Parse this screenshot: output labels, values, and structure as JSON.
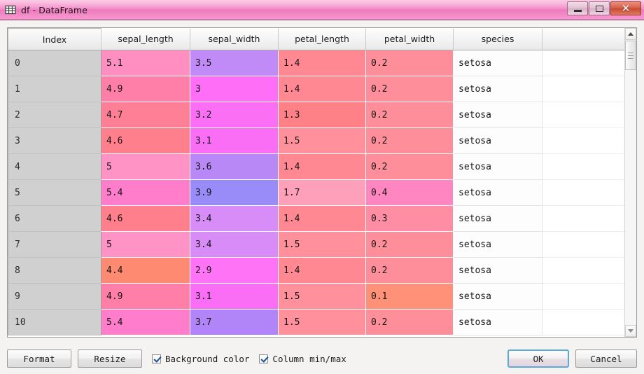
{
  "window": {
    "title": "df - DataFrame",
    "icon": "table-grid-icon",
    "minimize_label": "–",
    "maximize_label": "❐",
    "close_label": "✕"
  },
  "table": {
    "columns": [
      "Index",
      "sepal_length",
      "sepal_width",
      "petal_length",
      "petal_width",
      "species",
      ""
    ],
    "rows": [
      {
        "index": "0",
        "sepal_length": "5.1",
        "sepal_width": "3.5",
        "petal_length": "1.4",
        "petal_width": "0.2",
        "species": "setosa"
      },
      {
        "index": "1",
        "sepal_length": "4.9",
        "sepal_width": "3",
        "petal_length": "1.4",
        "petal_width": "0.2",
        "species": "setosa"
      },
      {
        "index": "2",
        "sepal_length": "4.7",
        "sepal_width": "3.2",
        "petal_length": "1.3",
        "petal_width": "0.2",
        "species": "setosa"
      },
      {
        "index": "3",
        "sepal_length": "4.6",
        "sepal_width": "3.1",
        "petal_length": "1.5",
        "petal_width": "0.2",
        "species": "setosa"
      },
      {
        "index": "4",
        "sepal_length": "5",
        "sepal_width": "3.6",
        "petal_length": "1.4",
        "petal_width": "0.2",
        "species": "setosa"
      },
      {
        "index": "5",
        "sepal_length": "5.4",
        "sepal_width": "3.9",
        "petal_length": "1.7",
        "petal_width": "0.4",
        "species": "setosa"
      },
      {
        "index": "6",
        "sepal_length": "4.6",
        "sepal_width": "3.4",
        "petal_length": "1.4",
        "petal_width": "0.3",
        "species": "setosa"
      },
      {
        "index": "7",
        "sepal_length": "5",
        "sepal_width": "3.4",
        "petal_length": "1.5",
        "petal_width": "0.2",
        "species": "setosa"
      },
      {
        "index": "8",
        "sepal_length": "4.4",
        "sepal_width": "2.9",
        "petal_length": "1.4",
        "petal_width": "0.2",
        "species": "setosa"
      },
      {
        "index": "9",
        "sepal_length": "4.9",
        "sepal_width": "3.1",
        "petal_length": "1.5",
        "petal_width": "0.1",
        "species": "setosa"
      },
      {
        "index": "10",
        "sepal_length": "5.4",
        "sepal_width": "3.7",
        "petal_length": "1.5",
        "petal_width": "0.2",
        "species": "setosa"
      }
    ],
    "cell_colors": {
      "sepal_length": [
        "#ff8fc0",
        "#ff7fa8",
        "#ff7f96",
        "#ff7f8c",
        "#ff93c6",
        "#ff7dcb",
        "#ff7f8c",
        "#ff93c6",
        "#ff8a72",
        "#ff7fa8",
        "#ff7dcb"
      ],
      "sepal_width": [
        "#c18bf7",
        "#ff6ef7",
        "#fb6ff5",
        "#f96ef4",
        "#b888f6",
        "#9a8cf8",
        "#d78cf7",
        "#d78cf7",
        "#ff73f6",
        "#f96ef4",
        "#b184f7"
      ],
      "petal_length": [
        "#ff8893",
        "#ff8893",
        "#ff8188",
        "#ff909c",
        "#ff8893",
        "#ffa0bb",
        "#ff8893",
        "#ff909c",
        "#ff8893",
        "#ff909c",
        "#ff909c"
      ],
      "petal_width": [
        "#ff8e9b",
        "#ff8e9b",
        "#ff8e9b",
        "#ff8e9b",
        "#ff8e9b",
        "#ff86c0",
        "#ff8ea4",
        "#ff8e9b",
        "#ff8e9b",
        "#ff9179",
        "#ff8e9b"
      ]
    }
  },
  "scrollbar": {
    "up_arrow": "triangle-up-icon",
    "down_arrow": "triangle-down-icon",
    "thumb": "scroll-thumb"
  },
  "toolbar": {
    "format_label": "Format",
    "resize_label": "Resize",
    "background_color_label": "Background color",
    "background_color_checked": true,
    "column_minmax_label": "Column min/max",
    "column_minmax_checked": true,
    "ok_label": "OK",
    "cancel_label": "Cancel"
  },
  "colors": {
    "titlebar_pink": "#f48fca",
    "close_red": "#d9604a",
    "index_gray": "#d0d0d0",
    "focus_blue": "#5aa9d6",
    "check_blue": "#14539c"
  }
}
